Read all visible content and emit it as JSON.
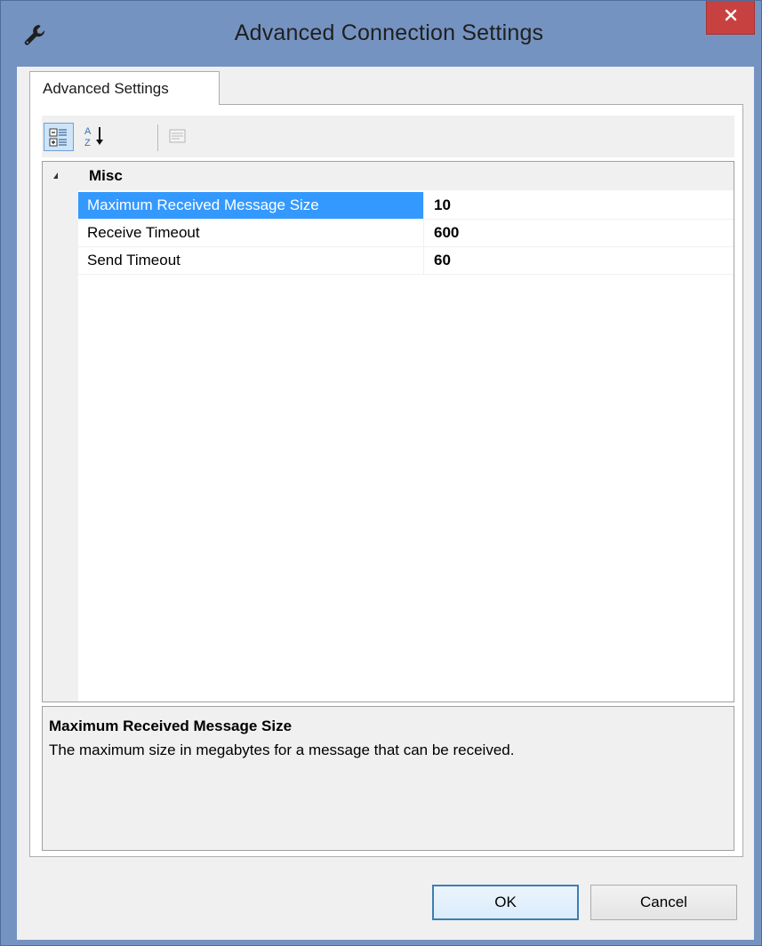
{
  "window": {
    "title": "Advanced Connection Settings",
    "close_symbol": "✕"
  },
  "tabs": [
    {
      "label": "Advanced Settings",
      "selected": true
    }
  ],
  "toolbar": {
    "buttons": [
      {
        "name": "categorized-view",
        "icon": "categorized-icon",
        "active": true
      },
      {
        "name": "alphabetical-view",
        "icon": "sort-az-icon",
        "active": false
      },
      {
        "name": "property-pages",
        "icon": "property-pages-icon",
        "active": false,
        "enabled": false
      }
    ]
  },
  "grid": {
    "category": "Misc",
    "properties": [
      {
        "name": "Maximum Received Message Size",
        "value": "10",
        "selected": true
      },
      {
        "name": "Receive Timeout",
        "value": "600",
        "selected": false
      },
      {
        "name": "Send Timeout",
        "value": "60",
        "selected": false
      }
    ]
  },
  "help": {
    "title": "Maximum Received Message Size",
    "description": "The maximum size in megabytes for a message that can be received."
  },
  "buttons": {
    "ok": "OK",
    "cancel": "Cancel"
  },
  "colors": {
    "selection": "#3399ff",
    "window_frame": "#7593c1",
    "close_button": "#c84141"
  }
}
